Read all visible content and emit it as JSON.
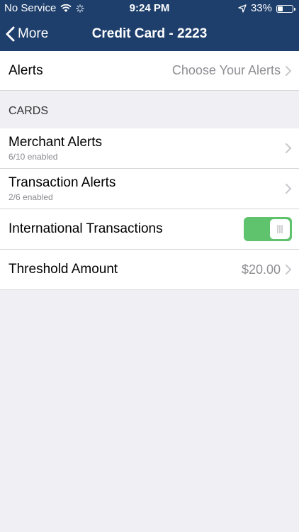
{
  "status_bar": {
    "carrier": "No Service",
    "time": "9:24 PM",
    "battery": "33%"
  },
  "nav": {
    "back_label": "More",
    "title": "Credit Card - 2223"
  },
  "alerts_row": {
    "label": "Alerts",
    "value": "Choose Your Alerts"
  },
  "cards_section": {
    "header": "CARDS",
    "merchant": {
      "label": "Merchant Alerts",
      "sub": "6/10 enabled"
    },
    "transaction": {
      "label": "Transaction Alerts",
      "sub": "2/6 enabled"
    },
    "international": {
      "label": "International Transactions",
      "enabled": true
    },
    "threshold": {
      "label": "Threshold Amount",
      "value": "$20.00"
    }
  },
  "colors": {
    "nav_bg": "#1e3f6c",
    "toggle_on": "#5fc36d"
  }
}
